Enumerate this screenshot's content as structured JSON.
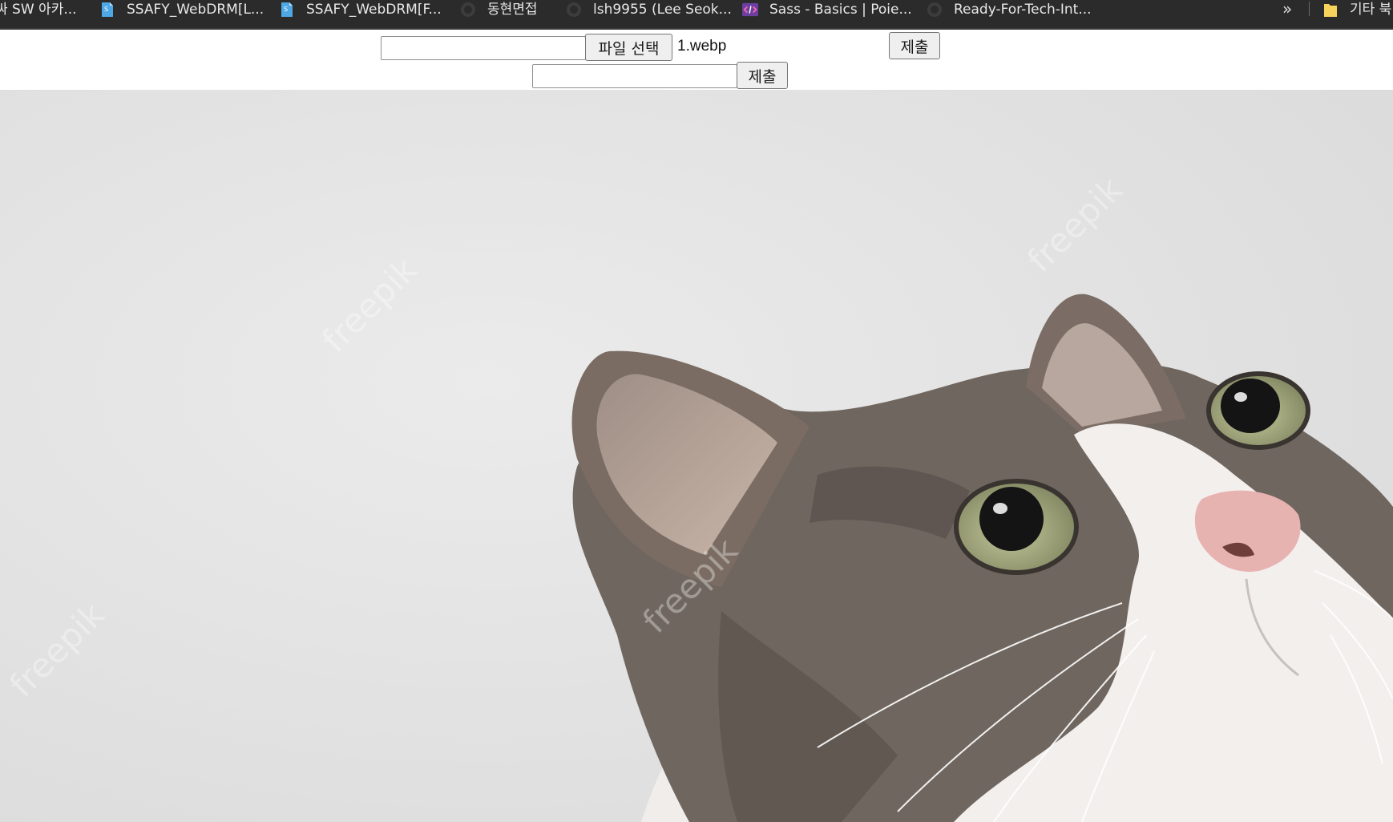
{
  "bookmarks_bar": {
    "items": [
      {
        "label": "싸 SW 아카...",
        "icon": "none"
      },
      {
        "label": "SSAFY_WebDRM[L...",
        "icon": "document-icon"
      },
      {
        "label": "SSAFY_WebDRM[F...",
        "icon": "document-icon"
      },
      {
        "label": "동현면접",
        "icon": "github-icon"
      },
      {
        "label": "lsh9955 (Lee Seok...",
        "icon": "github-icon"
      },
      {
        "label": "Sass - Basics | Poie...",
        "icon": "code-icon"
      },
      {
        "label": "Ready-For-Tech-Int...",
        "icon": "github-icon"
      }
    ],
    "overflow_label": "»",
    "other_bookmarks": "기타 북"
  },
  "form": {
    "upload_row": {
      "text_value": "",
      "file_button_label": "파일 선택",
      "file_name": "1.webp",
      "submit_label": "제출"
    },
    "second_row": {
      "text_value": "",
      "submit_label": "제출"
    }
  },
  "photo": {
    "subject": "gray and white tabby cat looking up against a light gray textured wall",
    "watermark": "freepik"
  },
  "colors": {
    "bookmark_bar_bg": "#2b2b2b",
    "bookmark_text": "#e8e8e8",
    "button_bg": "#efefef",
    "wall": "#e4e4e4",
    "cat_gray": "#6e6660",
    "cat_white": "#f3efed",
    "eye": "#a9ac7e",
    "nose": "#e7b3b1"
  }
}
